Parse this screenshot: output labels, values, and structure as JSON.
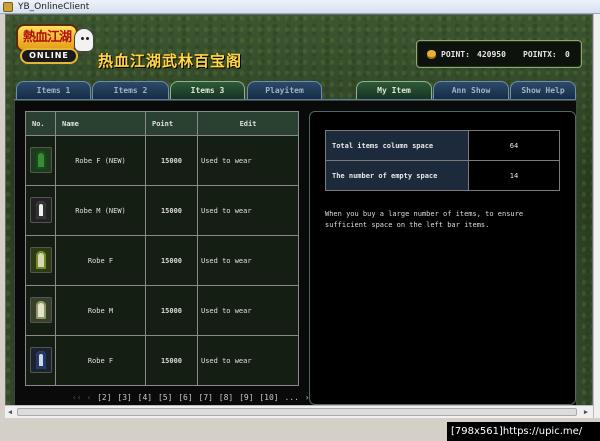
{
  "window": {
    "title": "YB_OnlineClient"
  },
  "header": {
    "logo": {
      "top_text": "熱血江湖",
      "bottom_text": "ONLINE"
    },
    "shop_title": "热血江湖武林百宝阁",
    "point_label": "POINT:",
    "point_value": "420950",
    "pointx_label": "POINTX:",
    "pointx_value": "0"
  },
  "tabs": [
    {
      "label": "Items 1",
      "active": false
    },
    {
      "label": "Items 2",
      "active": false
    },
    {
      "label": "Items 3",
      "active": true
    },
    {
      "label": "Playitem",
      "active": false
    },
    {
      "label": "My Item",
      "active": true
    },
    {
      "label": "Ann Show",
      "active": false
    },
    {
      "label": "Show Help",
      "active": false
    }
  ],
  "items_table": {
    "headers": [
      "No.",
      "Name",
      "Point",
      "Edit"
    ],
    "rows": [
      {
        "icon": "robe-green-icon",
        "name": "Robe F (NEW)",
        "point": "15000",
        "edit": "Used to wear"
      },
      {
        "icon": "robe-dark-icon",
        "name": "Robe M (NEW)",
        "point": "15000",
        "edit": "Used to wear"
      },
      {
        "icon": "robe-lime-icon",
        "name": "Robe F",
        "point": "15000",
        "edit": "Used to wear"
      },
      {
        "icon": "robe-cream-icon",
        "name": "Robe M",
        "point": "15000",
        "edit": "Used to wear"
      },
      {
        "icon": "robe-navy-icon",
        "name": "Robe F",
        "point": "15000",
        "edit": "Used to wear"
      }
    ]
  },
  "pagination": {
    "first_prev": "‹‹ ‹",
    "pages": [
      "[2]",
      "[3]",
      "[4]",
      "[5]",
      "[6]",
      "[7]",
      "[8]",
      "[9]",
      "[10]"
    ],
    "more": "...",
    "next_last": "› »"
  },
  "info": {
    "rows": [
      {
        "label": "Total items column space",
        "value": "64"
      },
      {
        "label": "The number of empty space",
        "value": "14"
      }
    ],
    "note": "When you buy a large number of items, to ensure sufficient space on the left bar items."
  },
  "watermark": "[798x561]https://upic.me/"
}
